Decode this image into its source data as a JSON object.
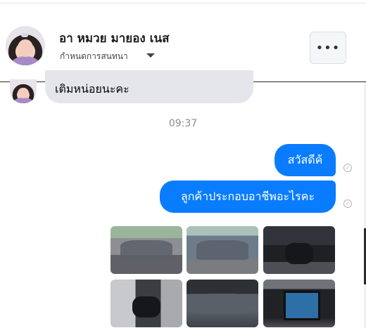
{
  "header": {
    "name": "อา หมวย มายอง เนส",
    "subtitle": "กำหนดการสนทนา",
    "more_label": "•••"
  },
  "messages": {
    "incoming_partial": "เติมหน่อยนะคะ",
    "time": "09:37",
    "outgoing": [
      {
        "text": "สวัสดีค้"
      },
      {
        "text": "ลูกค้าประกอบอาชีพอะไรคะ"
      }
    ],
    "status_glyph": "✓"
  },
  "photos": [
    {
      "subject": "gray pickup truck rear view"
    },
    {
      "subject": "gray pickup truck front view"
    },
    {
      "subject": "car interior dashboard"
    },
    {
      "subject": "open door interior"
    },
    {
      "subject": "engine bay"
    },
    {
      "subject": "infotainment screen"
    }
  ],
  "colors": {
    "accent": "#0a7cff",
    "incoming_bubble": "#e4e6eb",
    "timestamp": "#8a8d91"
  },
  "icons": [
    "more-icon",
    "chevron-down-icon",
    "sent-check-icon"
  ]
}
